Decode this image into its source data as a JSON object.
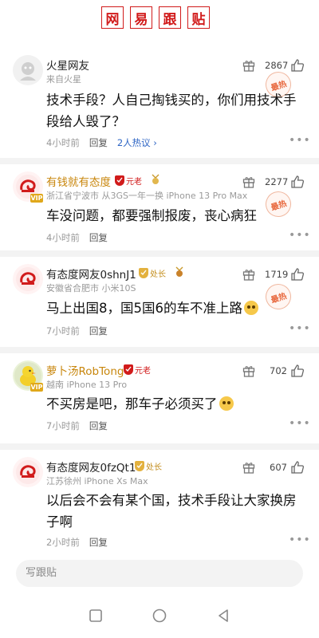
{
  "header": {
    "title_chars": [
      "网",
      "易",
      "跟",
      "贴"
    ]
  },
  "comments": [
    {
      "user": "火星网友",
      "location": "来自火星",
      "text": "技术手段？人自己掏钱买的，你们用技术手段给人毁了？",
      "time": "4小时前",
      "reply": "回复",
      "hot_discussion": "2人热议 ›",
      "likes": "2867",
      "stamp": "最热"
    },
    {
      "user": "有钱就有态度",
      "badge": "元老",
      "location": "浙江省宁波市  从3GS一年一换 iPhone 13 Pro Max",
      "text": "车没问题，都要强制报废，丧心病狂",
      "time": "4小时前",
      "reply": "回复",
      "likes": "2277",
      "stamp": "最热",
      "vip": "VIP"
    },
    {
      "user": "有态度网友0shnJ1",
      "badge": "处长",
      "location": "安徽省合肥市  小米10S",
      "text": "马上出国8，国5国6的车不准上路",
      "time": "7小时前",
      "reply": "回复",
      "likes": "1719",
      "stamp": "最热"
    },
    {
      "user": "萝卜汤RobTong",
      "badge": "元老",
      "location": "越南  iPhone 13 Pro",
      "text": "不买房是吧，那车子必须买了",
      "time": "7小时前",
      "reply": "回复",
      "likes": "702",
      "vip": "VIP"
    },
    {
      "user": "有态度网友0fzQt1",
      "badge": "处长",
      "location": "江苏徐州  iPhone Xs Max",
      "text": "以后会不会有某个国，技术手段让大家换房子啊",
      "time": "2小时前",
      "reply": "回复",
      "likes": "607"
    }
  ],
  "compose": {
    "placeholder": "写跟贴"
  },
  "colors": {
    "brand_red": "#d11b1b",
    "gold_name": "#c8860c",
    "link_blue": "#2f66c5"
  }
}
